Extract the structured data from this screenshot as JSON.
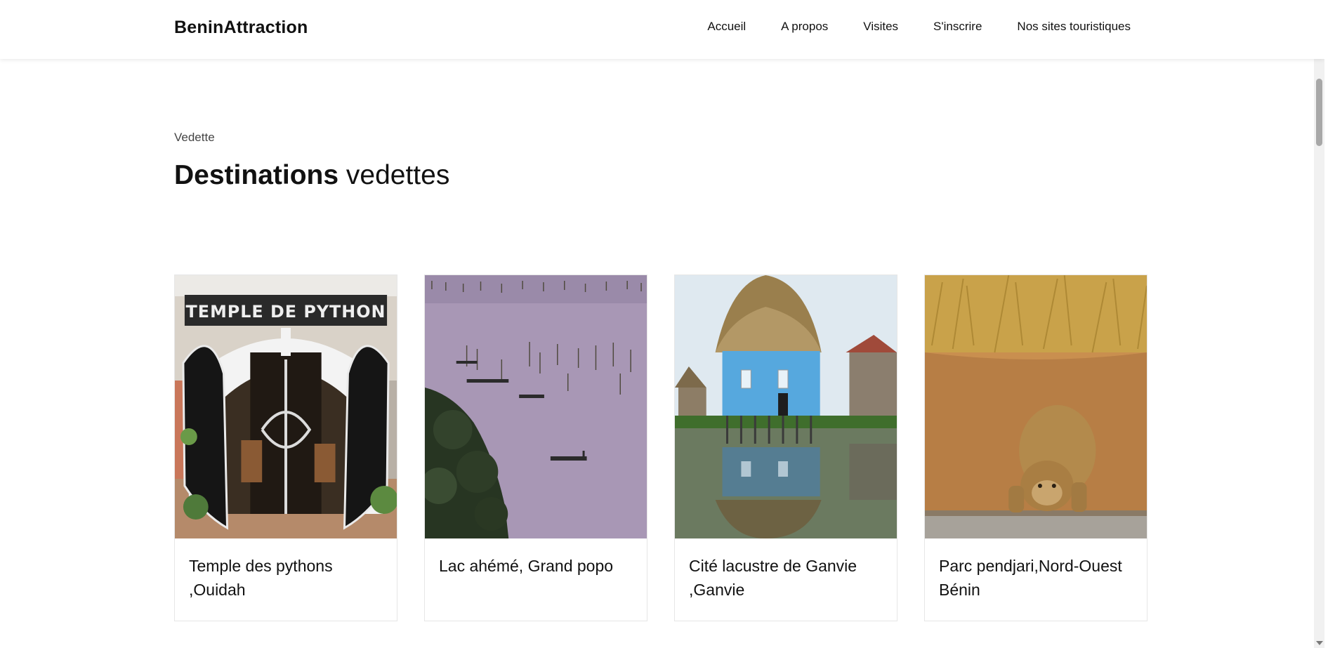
{
  "header": {
    "brand": "BeninAttraction",
    "nav": [
      "Accueil",
      "A propos",
      "Visites",
      "S'inscrire",
      "Nos sites touristiques"
    ]
  },
  "section": {
    "eyebrow": "Vedette",
    "heading_bold": "Destinations",
    "heading_rest": " vedettes"
  },
  "cards": [
    {
      "title": "Temple des pythons ,Ouidah",
      "image": "temple-photo",
      "sign_text": "TEMPLE DE PYTHON"
    },
    {
      "title": "Lac ahémé, Grand popo",
      "image": "lake-photo"
    },
    {
      "title": "Cité lacustre de Ganvie ,Ganvie",
      "image": "stilt-house-photo"
    },
    {
      "title": "Parc pendjari,Nord-Ouest Bénin",
      "image": "lion-photo"
    }
  ]
}
